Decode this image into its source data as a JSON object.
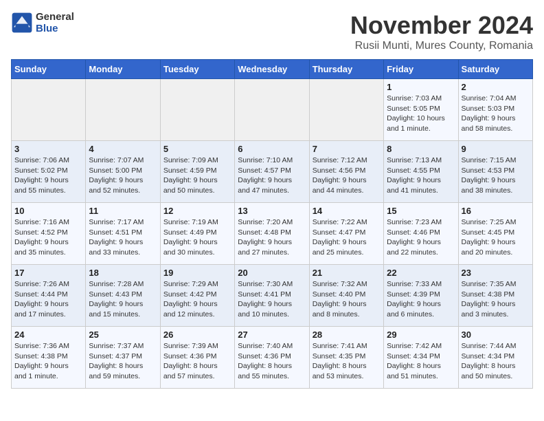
{
  "header": {
    "logo_general": "General",
    "logo_blue": "Blue",
    "month_title": "November 2024",
    "subtitle": "Rusii Munti, Mures County, Romania"
  },
  "days_of_week": [
    "Sunday",
    "Monday",
    "Tuesday",
    "Wednesday",
    "Thursday",
    "Friday",
    "Saturday"
  ],
  "weeks": [
    [
      {
        "day": "",
        "info": ""
      },
      {
        "day": "",
        "info": ""
      },
      {
        "day": "",
        "info": ""
      },
      {
        "day": "",
        "info": ""
      },
      {
        "day": "",
        "info": ""
      },
      {
        "day": "1",
        "info": "Sunrise: 7:03 AM\nSunset: 5:05 PM\nDaylight: 10 hours\nand 1 minute."
      },
      {
        "day": "2",
        "info": "Sunrise: 7:04 AM\nSunset: 5:03 PM\nDaylight: 9 hours\nand 58 minutes."
      }
    ],
    [
      {
        "day": "3",
        "info": "Sunrise: 7:06 AM\nSunset: 5:02 PM\nDaylight: 9 hours\nand 55 minutes."
      },
      {
        "day": "4",
        "info": "Sunrise: 7:07 AM\nSunset: 5:00 PM\nDaylight: 9 hours\nand 52 minutes."
      },
      {
        "day": "5",
        "info": "Sunrise: 7:09 AM\nSunset: 4:59 PM\nDaylight: 9 hours\nand 50 minutes."
      },
      {
        "day": "6",
        "info": "Sunrise: 7:10 AM\nSunset: 4:57 PM\nDaylight: 9 hours\nand 47 minutes."
      },
      {
        "day": "7",
        "info": "Sunrise: 7:12 AM\nSunset: 4:56 PM\nDaylight: 9 hours\nand 44 minutes."
      },
      {
        "day": "8",
        "info": "Sunrise: 7:13 AM\nSunset: 4:55 PM\nDaylight: 9 hours\nand 41 minutes."
      },
      {
        "day": "9",
        "info": "Sunrise: 7:15 AM\nSunset: 4:53 PM\nDaylight: 9 hours\nand 38 minutes."
      }
    ],
    [
      {
        "day": "10",
        "info": "Sunrise: 7:16 AM\nSunset: 4:52 PM\nDaylight: 9 hours\nand 35 minutes."
      },
      {
        "day": "11",
        "info": "Sunrise: 7:17 AM\nSunset: 4:51 PM\nDaylight: 9 hours\nand 33 minutes."
      },
      {
        "day": "12",
        "info": "Sunrise: 7:19 AM\nSunset: 4:49 PM\nDaylight: 9 hours\nand 30 minutes."
      },
      {
        "day": "13",
        "info": "Sunrise: 7:20 AM\nSunset: 4:48 PM\nDaylight: 9 hours\nand 27 minutes."
      },
      {
        "day": "14",
        "info": "Sunrise: 7:22 AM\nSunset: 4:47 PM\nDaylight: 9 hours\nand 25 minutes."
      },
      {
        "day": "15",
        "info": "Sunrise: 7:23 AM\nSunset: 4:46 PM\nDaylight: 9 hours\nand 22 minutes."
      },
      {
        "day": "16",
        "info": "Sunrise: 7:25 AM\nSunset: 4:45 PM\nDaylight: 9 hours\nand 20 minutes."
      }
    ],
    [
      {
        "day": "17",
        "info": "Sunrise: 7:26 AM\nSunset: 4:44 PM\nDaylight: 9 hours\nand 17 minutes."
      },
      {
        "day": "18",
        "info": "Sunrise: 7:28 AM\nSunset: 4:43 PM\nDaylight: 9 hours\nand 15 minutes."
      },
      {
        "day": "19",
        "info": "Sunrise: 7:29 AM\nSunset: 4:42 PM\nDaylight: 9 hours\nand 12 minutes."
      },
      {
        "day": "20",
        "info": "Sunrise: 7:30 AM\nSunset: 4:41 PM\nDaylight: 9 hours\nand 10 minutes."
      },
      {
        "day": "21",
        "info": "Sunrise: 7:32 AM\nSunset: 4:40 PM\nDaylight: 9 hours\nand 8 minutes."
      },
      {
        "day": "22",
        "info": "Sunrise: 7:33 AM\nSunset: 4:39 PM\nDaylight: 9 hours\nand 6 minutes."
      },
      {
        "day": "23",
        "info": "Sunrise: 7:35 AM\nSunset: 4:38 PM\nDaylight: 9 hours\nand 3 minutes."
      }
    ],
    [
      {
        "day": "24",
        "info": "Sunrise: 7:36 AM\nSunset: 4:38 PM\nDaylight: 9 hours\nand 1 minute."
      },
      {
        "day": "25",
        "info": "Sunrise: 7:37 AM\nSunset: 4:37 PM\nDaylight: 8 hours\nand 59 minutes."
      },
      {
        "day": "26",
        "info": "Sunrise: 7:39 AM\nSunset: 4:36 PM\nDaylight: 8 hours\nand 57 minutes."
      },
      {
        "day": "27",
        "info": "Sunrise: 7:40 AM\nSunset: 4:36 PM\nDaylight: 8 hours\nand 55 minutes."
      },
      {
        "day": "28",
        "info": "Sunrise: 7:41 AM\nSunset: 4:35 PM\nDaylight: 8 hours\nand 53 minutes."
      },
      {
        "day": "29",
        "info": "Sunrise: 7:42 AM\nSunset: 4:34 PM\nDaylight: 8 hours\nand 51 minutes."
      },
      {
        "day": "30",
        "info": "Sunrise: 7:44 AM\nSunset: 4:34 PM\nDaylight: 8 hours\nand 50 minutes."
      }
    ]
  ]
}
